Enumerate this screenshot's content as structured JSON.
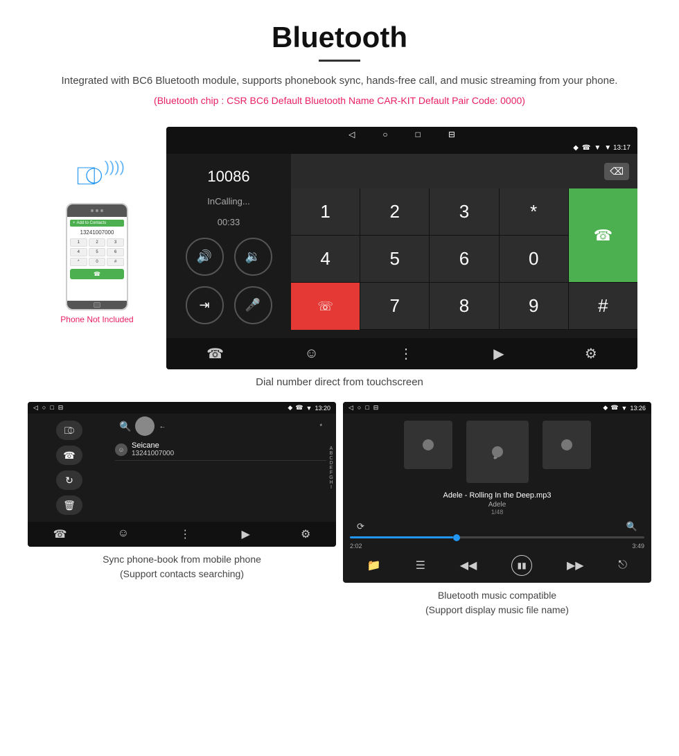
{
  "header": {
    "title": "Bluetooth",
    "description": "Integrated with BC6 Bluetooth module, supports phonebook sync, hands-free call, and music streaming from your phone.",
    "specs": "(Bluetooth chip : CSR BC6    Default Bluetooth Name CAR-KIT    Default Pair Code: 0000)"
  },
  "main_screen": {
    "status_bar": {
      "left_icons": [
        "◁",
        "○",
        "□",
        "⊟"
      ],
      "right_icons": [
        "♦",
        "✆",
        "▼ 13:17"
      ]
    },
    "dial_number": "10086",
    "call_status": "InCalling...",
    "call_timer": "00:33",
    "keypad": [
      "1",
      "2",
      "3",
      "*",
      "4",
      "5",
      "6",
      "0",
      "7",
      "8",
      "9",
      "#"
    ],
    "caption": "Dial number direct from touchscreen"
  },
  "phone_mockup": {
    "not_included_label": "Phone Not Included"
  },
  "phonebook_screen": {
    "status_bar_time": "13:20",
    "contact_name": "Seicane",
    "contact_number": "13241007000",
    "alphabet": [
      "A",
      "B",
      "C",
      "D",
      "E",
      "F",
      "G",
      "H",
      "I"
    ],
    "caption_line1": "Sync phone-book from mobile phone",
    "caption_line2": "(Support contacts searching)"
  },
  "music_screen": {
    "status_bar_time": "13:26",
    "song_title": "Adele - Rolling In the Deep.mp3",
    "artist": "Adele",
    "track_info": "1/48",
    "time_current": "2:02",
    "time_total": "3:49",
    "caption_line1": "Bluetooth music compatible",
    "caption_line2": "(Support display music file name)"
  }
}
